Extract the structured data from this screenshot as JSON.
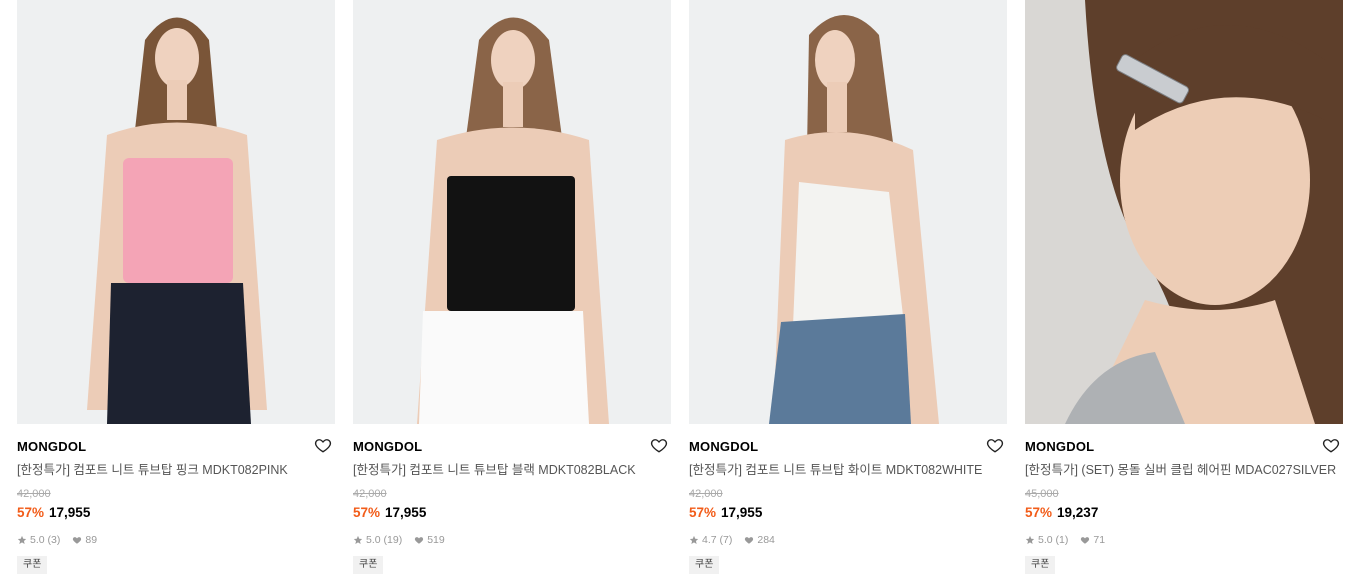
{
  "products": [
    {
      "brand": "MONGDOL",
      "name": "[한정특가] 컴포트 니트 튜브탑 핑크 MDKT082PINK",
      "original_price": "42,000",
      "discount": "57%",
      "price": "17,955",
      "rating": "5.0",
      "review_count": "(3)",
      "likes": "89",
      "coupon": "쿠폰",
      "top_color": "#f4a4b6",
      "bottom_color": "#1d2230"
    },
    {
      "brand": "MONGDOL",
      "name": "[한정특가] 컴포트 니트 튜브탑 블랙 MDKT082BLACK",
      "original_price": "42,000",
      "discount": "57%",
      "price": "17,955",
      "rating": "5.0",
      "review_count": "(19)",
      "likes": "519",
      "coupon": "쿠폰",
      "top_color": "#121212",
      "bottom_color": "#fafafa"
    },
    {
      "brand": "MONGDOL",
      "name": "[한정특가] 컴포트 니트 튜브탑 화이트 MDKT082WHITE",
      "original_price": "42,000",
      "discount": "57%",
      "price": "17,955",
      "rating": "4.7",
      "review_count": "(7)",
      "likes": "284",
      "coupon": "쿠폰",
      "top_color": "#f3f3f1",
      "bottom_color": "#5b7a9a"
    },
    {
      "brand": "MONGDOL",
      "name": "[한정특가] (SET) 몽돌 실버 클립 헤어핀 MDAC027SILVER",
      "original_price": "45,000",
      "discount": "57%",
      "price": "19,237",
      "rating": "5.0",
      "review_count": "(1)",
      "likes": "71",
      "coupon": "쿠폰",
      "top_color": "#aeb1b4",
      "bottom_color": "#6b4a32"
    }
  ],
  "icons": {
    "like": "heart-outline-icon",
    "star": "star-icon",
    "likes_count": "heart-filled-icon"
  },
  "colors": {
    "discount": "#f25c19",
    "muted_text": "#999999",
    "coupon_bg": "#f1f1f1"
  }
}
